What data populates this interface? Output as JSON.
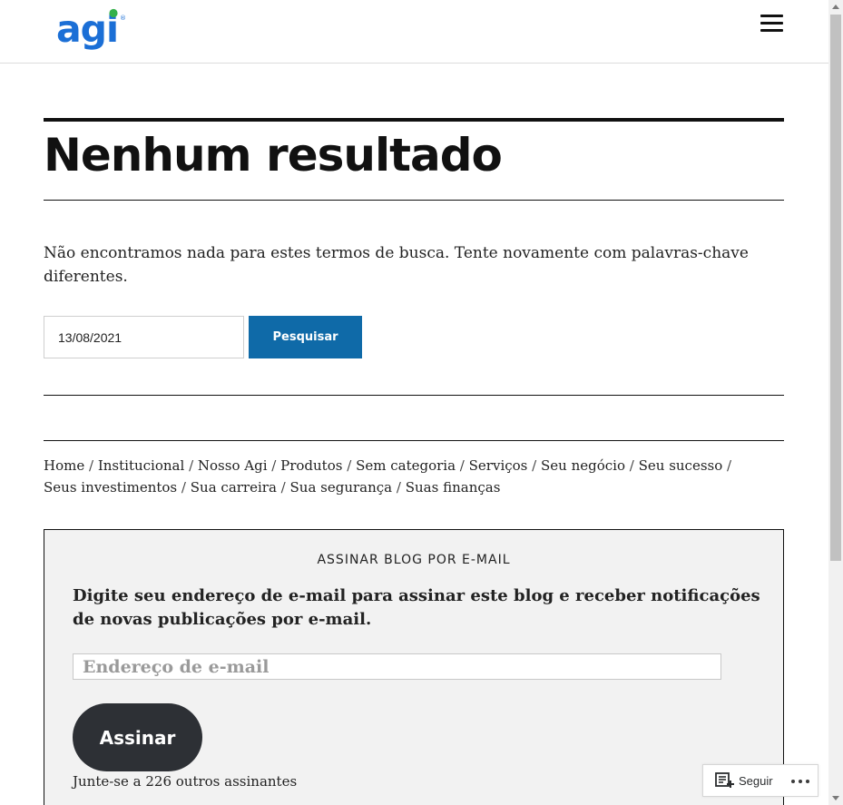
{
  "header": {
    "logo_text": "agi",
    "logo_mark": "®",
    "logo_color": "#1b6fd6",
    "logo_dot_color": "#35b14a",
    "menu_icon": "hamburger-menu-icon"
  },
  "main": {
    "title": "Nenhum resultado",
    "message": "Não encontramos nada para estes termos de busca. Tente novamente com palavras-chave diferentes.",
    "search": {
      "value": "13/08/2021",
      "button_label": "Pesquisar",
      "button_color": "#0f6aa8"
    },
    "categories": [
      {
        "label": "Home"
      },
      {
        "label": "Institucional"
      },
      {
        "label": "Nosso Agi"
      },
      {
        "label": "Produtos"
      },
      {
        "label": "Sem categoria"
      },
      {
        "label": "Serviços"
      },
      {
        "label": "Seu negócio"
      },
      {
        "label": "Seu sucesso"
      },
      {
        "label": "Seus investimentos"
      },
      {
        "label": "Sua carreira"
      },
      {
        "label": "Sua segurança"
      },
      {
        "label": "Suas finanças"
      }
    ],
    "category_separator": "/"
  },
  "subscribe": {
    "title": "ASSINAR BLOG POR E-MAIL",
    "description": "Digite seu endereço de e-mail para assinar este blog e receber notificações de novas publicações por e-mail.",
    "email_placeholder": "Endereço de e-mail",
    "button_label": "Assinar",
    "subscriber_text": "Junte-se a 226 outros assinantes"
  },
  "follow_bar": {
    "follow_label": "Seguir",
    "follow_icon": "reader-follow-icon",
    "more_icon": "more-dots-icon"
  }
}
